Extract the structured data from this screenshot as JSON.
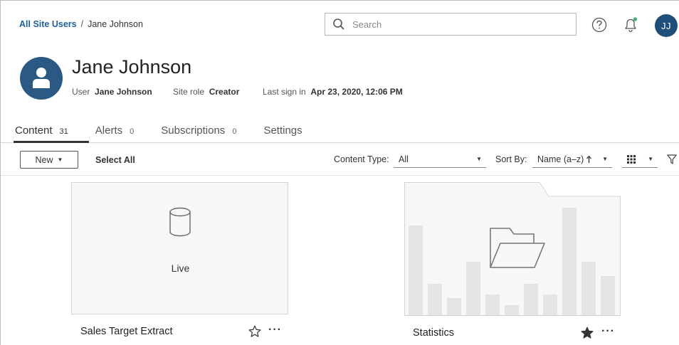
{
  "breadcrumb": {
    "parent": "All Site Users",
    "separator": "/",
    "current": "Jane Johnson"
  },
  "search": {
    "placeholder": "Search"
  },
  "header_icons": {
    "help": "help-circle-icon",
    "notifications": "bell-icon"
  },
  "current_user": {
    "initials": "JJ",
    "avatar_color": "#1e4f7b"
  },
  "profile": {
    "name": "Jane Johnson",
    "user_label": "User",
    "user_value": "Jane Johnson",
    "role_label": "Site role",
    "role_value": "Creator",
    "signin_label": "Last sign in",
    "signin_value": "Apr 23, 2020, 12:06 PM"
  },
  "tabs": [
    {
      "label": "Content",
      "count": "31",
      "active": true
    },
    {
      "label": "Alerts",
      "count": "0",
      "active": false
    },
    {
      "label": "Subscriptions",
      "count": "0",
      "active": false
    },
    {
      "label": "Settings",
      "count": "",
      "active": false
    }
  ],
  "toolbar": {
    "new_label": "New",
    "select_all_label": "Select All",
    "content_type_label": "Content Type:",
    "content_type_value": "All",
    "sort_label": "Sort By:",
    "sort_value": "Name (a–z)",
    "sort_direction_icon": "arrow-up-icon",
    "view_icon": "grid-view-icon",
    "filter_icon": "filter-icon"
  },
  "cards": [
    {
      "title": "Sales Target Extract",
      "thumbnail_label": "Live",
      "thumbnail_icon": "database-icon",
      "favorite": false
    },
    {
      "title": "Statistics",
      "thumbnail_icon": "open-folder-icon",
      "favorite": true
    }
  ],
  "colors": {
    "link": "#1f5f9e",
    "avatar": "#2a5a83",
    "bell_dot": "#3fae73"
  }
}
